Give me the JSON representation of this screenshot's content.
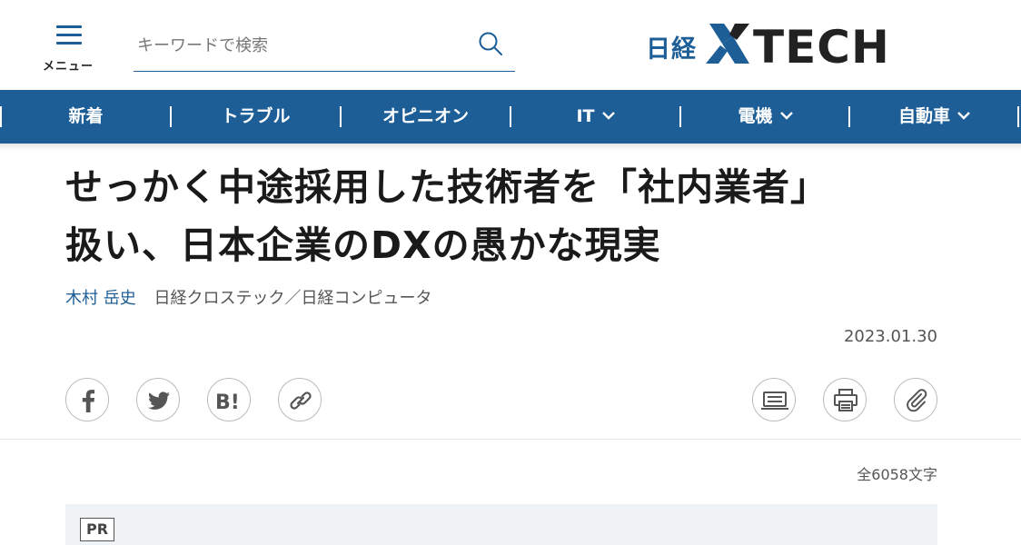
{
  "header": {
    "menu_label": "メニュー",
    "search_placeholder": "キーワードで検索",
    "logo_prefix": "日経",
    "logo_text": "XTECH",
    "brand_color": "#1d5e97"
  },
  "nav": {
    "items": [
      {
        "label": "新着",
        "has_dropdown": false
      },
      {
        "label": "トラブル",
        "has_dropdown": false
      },
      {
        "label": "オピニオン",
        "has_dropdown": false
      },
      {
        "label": "IT",
        "has_dropdown": true
      },
      {
        "label": "電機",
        "has_dropdown": true
      },
      {
        "label": "自動車",
        "has_dropdown": true
      }
    ]
  },
  "article": {
    "title_line1": "せっかく中途採用した技術者を「社内業者」",
    "title_line2": "扱い、日本企業のDXの愚かな現実",
    "author": "木村 岳史",
    "publication": "日経クロステック／日経コンピュータ",
    "date": "2023.01.30",
    "char_count": "全6058文字",
    "pr_label": "PR"
  },
  "share_icons": [
    "facebook-icon",
    "twitter-icon",
    "hatena-bookmark-icon",
    "link-icon"
  ],
  "tool_icons": [
    "text-view-icon",
    "print-icon",
    "clip-icon"
  ]
}
